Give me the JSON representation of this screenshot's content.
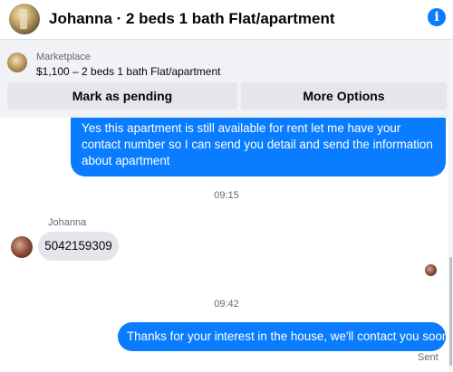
{
  "header": {
    "title": "Johanna · 2 beds 1 bath Flat/apartment",
    "info_icon": "i"
  },
  "marketplace": {
    "label": "Marketplace",
    "listing": "$1,100 – 2 beds 1 bath Flat/apartment",
    "pending_button": "Mark as pending",
    "more_button": "More Options"
  },
  "messages": {
    "outgoing_first": "Yes this apartment is still available for rent let me have your contact number so I can send you detail and send the information about apartment",
    "timestamp_1": "09:15",
    "sender_name": "Johanna",
    "incoming": "5042159309",
    "timestamp_2": "09:42",
    "outgoing_last": "Thanks for your interest in the house, we'll contact you soon",
    "status": "Sent"
  },
  "colors": {
    "accent": "#0a7cff",
    "incoming_bubble": "#e4e6eb",
    "panel_bg": "#f0f2f5"
  }
}
